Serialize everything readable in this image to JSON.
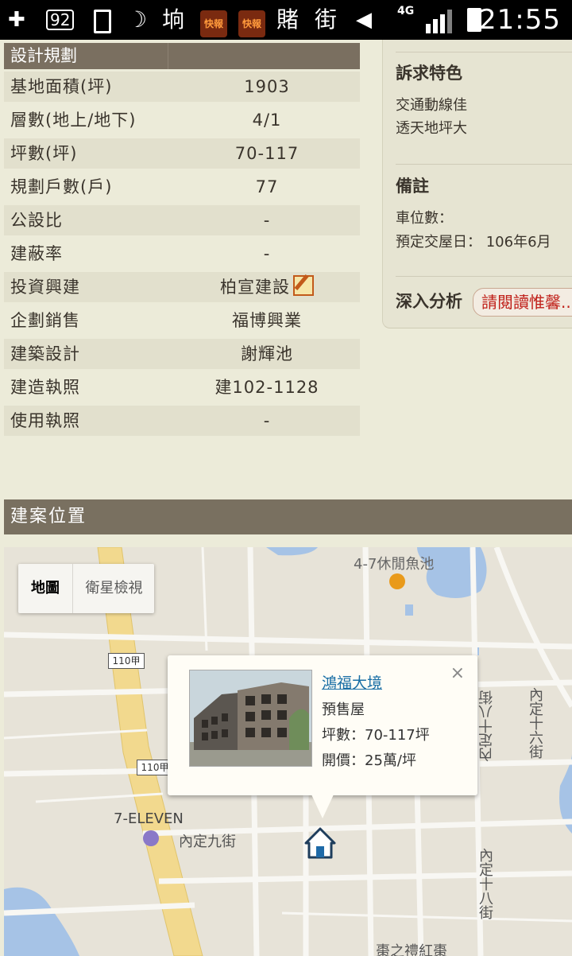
{
  "status_bar": {
    "badge_text": "92",
    "tabloid_badge_1": "快報",
    "tabloid_badge_2": "快報",
    "char_1": "賭",
    "char_2": "街",
    "network": "4G",
    "time": "21:55"
  },
  "spec": {
    "header": "設計規劃",
    "rows": [
      {
        "label": "基地面積(坪)",
        "value": "1903"
      },
      {
        "label": "層數(地上/地下)",
        "value": "4/1"
      },
      {
        "label": "坪數(坪)",
        "value": "70-117"
      },
      {
        "label": "規劃戶數(戶)",
        "value": "77"
      },
      {
        "label": "公設比",
        "value": "-"
      },
      {
        "label": "建蔽率",
        "value": "-"
      },
      {
        "label": "投資興建",
        "value": "柏宣建設"
      },
      {
        "label": "企劃銷售",
        "value": "福博興業"
      },
      {
        "label": "建築設計",
        "value": "謝輝池"
      },
      {
        "label": "建造執照",
        "value": "建102-1128"
      },
      {
        "label": "使用執照",
        "value": "-"
      }
    ]
  },
  "right_panel": {
    "features_title": "訴求特色",
    "features": [
      "交通動線佳",
      "透天地坪大"
    ],
    "notes_title": "備註",
    "notes": [
      "車位數：",
      "預定交屋日： 106年6月"
    ],
    "analysis_title": "深入分析",
    "analysis_button": "請閱讀惟馨..."
  },
  "location": {
    "header": "建案位置"
  },
  "map": {
    "type_map": "地圖",
    "type_satellite": "衛星檢視",
    "labels": {
      "pond": "4-7休閒魚池",
      "store": "7-ELEVEN",
      "street_9": "內定九街",
      "street_16": "內定十六街",
      "street_18": "內定十八街",
      "street_18_upper": "內定十八街",
      "place_bottom": "棗之禮紅棗",
      "road_110a": "110甲",
      "road_110b": "110甲"
    },
    "info_window": {
      "title": "鴻福大境",
      "status": "預售屋",
      "size": "坪數：70-117坪",
      "price": "開價：25萬/坪",
      "close": "×"
    }
  },
  "colors": {
    "header_bg": "#7a6f60",
    "link": "#1a6fa5",
    "accent_red": "#c0201a"
  }
}
